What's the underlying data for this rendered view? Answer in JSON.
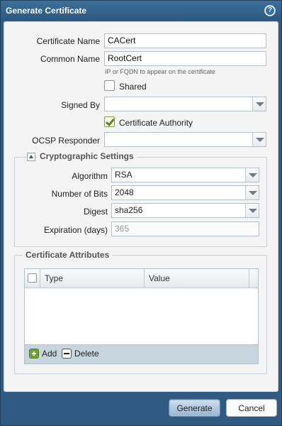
{
  "dialog": {
    "title": "Generate Certificate",
    "help_icon": "help-icon"
  },
  "form": {
    "certificate_name": {
      "label": "Certificate Name",
      "value": "CACert"
    },
    "common_name": {
      "label": "Common Name",
      "value": "RootCert",
      "hint": "IP or FQDN to appear on the certificate"
    },
    "shared": {
      "label": "Shared",
      "checked": false
    },
    "signed_by": {
      "label": "Signed By",
      "value": ""
    },
    "certificate_authority": {
      "label": "Certificate Authority",
      "checked": true
    },
    "ocsp_responder": {
      "label": "OCSP Responder",
      "value": ""
    }
  },
  "crypto": {
    "legend": "Cryptographic Settings",
    "algorithm": {
      "label": "Algorithm",
      "value": "RSA"
    },
    "bits": {
      "label": "Number of Bits",
      "value": "2048"
    },
    "digest": {
      "label": "Digest",
      "value": "sha256"
    },
    "expiration": {
      "label": "Expiration (days)",
      "placeholder": "365"
    }
  },
  "attributes": {
    "legend": "Certificate Attributes",
    "columns": [
      "Type",
      "Value"
    ],
    "rows": [],
    "add_label": "Add",
    "delete_label": "Delete"
  },
  "footer": {
    "generate_label": "Generate",
    "cancel_label": "Cancel"
  },
  "colors": {
    "titlebar": "#2f5b82",
    "add_icon": "#6ca22d",
    "checkmark": "#5b8a1a"
  }
}
